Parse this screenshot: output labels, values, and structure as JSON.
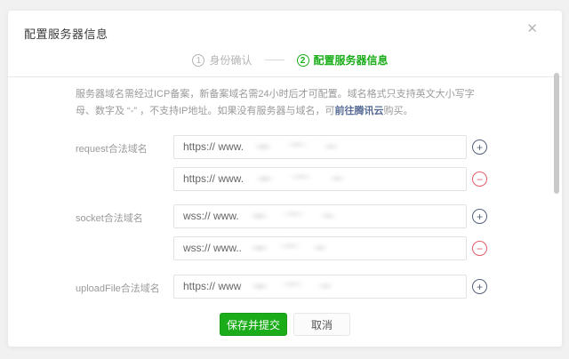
{
  "dialog": {
    "title": "配置服务器信息",
    "close_glyph": "✕",
    "steps": [
      {
        "number": "1",
        "label": "身份确认",
        "state": "inactive"
      },
      {
        "number": "2",
        "label": "配置服务器信息",
        "state": "active"
      }
    ],
    "description": {
      "text": "服务器域名需经过ICP备案，新备案域名需24小时后才可配置。域名格式只支持英文大小写字母、数字及 “-” ，不支持IP地址。如果没有服务器与域名，可",
      "link": "前往腾讯云",
      "suffix": "购买。"
    },
    "form": {
      "fields": [
        {
          "label": "request合法域名",
          "rows": [
            {
              "value": "https:// www.",
              "action": "add"
            },
            {
              "value": "https:// www.",
              "action": "remove"
            }
          ]
        },
        {
          "label": "socket合法域名",
          "rows": [
            {
              "value": "wss:// www.",
              "action": "add"
            },
            {
              "value": "wss:// www..",
              "action": "remove"
            }
          ]
        },
        {
          "label": "uploadFile合法域名",
          "rows": [
            {
              "value": "https:// www",
              "action": "add"
            }
          ]
        }
      ]
    },
    "icons": {
      "add": "+",
      "remove": "−"
    },
    "buttons": {
      "submit": "保存并提交",
      "cancel": "取消"
    },
    "colors": {
      "primary_green": "#1aad19",
      "remove_red": "#e15d68",
      "add_gray": "#55617a",
      "link_blue": "#576b95",
      "step_inactive": "#b4b4b4"
    }
  }
}
